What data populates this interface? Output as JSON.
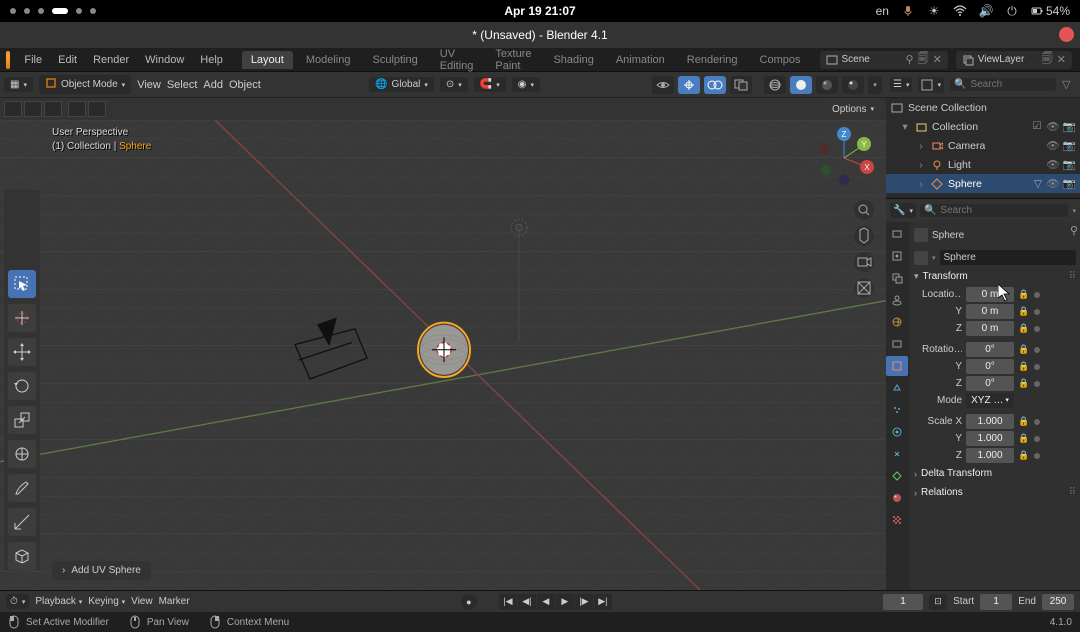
{
  "system": {
    "datetime": "Apr 19  21:07",
    "lang": "en",
    "battery": "54%"
  },
  "titlebar": {
    "title": "* (Unsaved) - Blender 4.1"
  },
  "menu": {
    "items": [
      "File",
      "Edit",
      "Render",
      "Window",
      "Help"
    ],
    "tabs": [
      "Layout",
      "Modeling",
      "Sculpting",
      "UV Editing",
      "Texture Paint",
      "Shading",
      "Animation",
      "Rendering",
      "Compos"
    ],
    "scene_field": "Scene",
    "layer_field": "ViewLayer"
  },
  "vp_header": {
    "mode": "Object Mode",
    "menus": [
      "View",
      "Select",
      "Add",
      "Object"
    ],
    "orient": "Global",
    "options": "Options"
  },
  "vp_info": {
    "line1": "User Perspective",
    "collection": "(1) Collection",
    "object": "Sphere"
  },
  "add_panel": "Add UV Sphere",
  "outliner": {
    "search_ph": "Search",
    "root": "Scene Collection",
    "collection": "Collection",
    "items": [
      {
        "label": "Camera",
        "icon": "camera"
      },
      {
        "label": "Light",
        "icon": "light"
      },
      {
        "label": "Sphere",
        "icon": "mesh"
      }
    ]
  },
  "properties": {
    "search_ph": "Search",
    "breadcrumb": "Sphere",
    "name": "Sphere",
    "sections": {
      "transform": "Transform",
      "delta": "Delta Transform",
      "relations": "Relations"
    },
    "location": {
      "label": "Locatio…",
      "x": "0 m",
      "y": "0 m",
      "z": "0 m",
      "ylabel": "Y",
      "zlabel": "Z"
    },
    "rotation": {
      "label": "Rotatio…",
      "x": "0°",
      "y": "0°",
      "z": "0°",
      "ylabel": "Y",
      "zlabel": "Z",
      "modelabel": "Mode",
      "mode": "XYZ …"
    },
    "scale": {
      "label": "Scale X",
      "x": "1.000",
      "y": "1.000",
      "z": "1.000",
      "ylabel": "Y",
      "zlabel": "Z"
    }
  },
  "timeline": {
    "playback": "Playback",
    "keying": "Keying",
    "view": "View",
    "marker": "Marker",
    "current": "1",
    "start_label": "Start",
    "start": "1",
    "end_label": "End",
    "end": "250"
  },
  "status": {
    "left": "Set Active Modifier",
    "mid1": "Pan View",
    "mid2": "Context Menu",
    "version": "4.1.0"
  }
}
